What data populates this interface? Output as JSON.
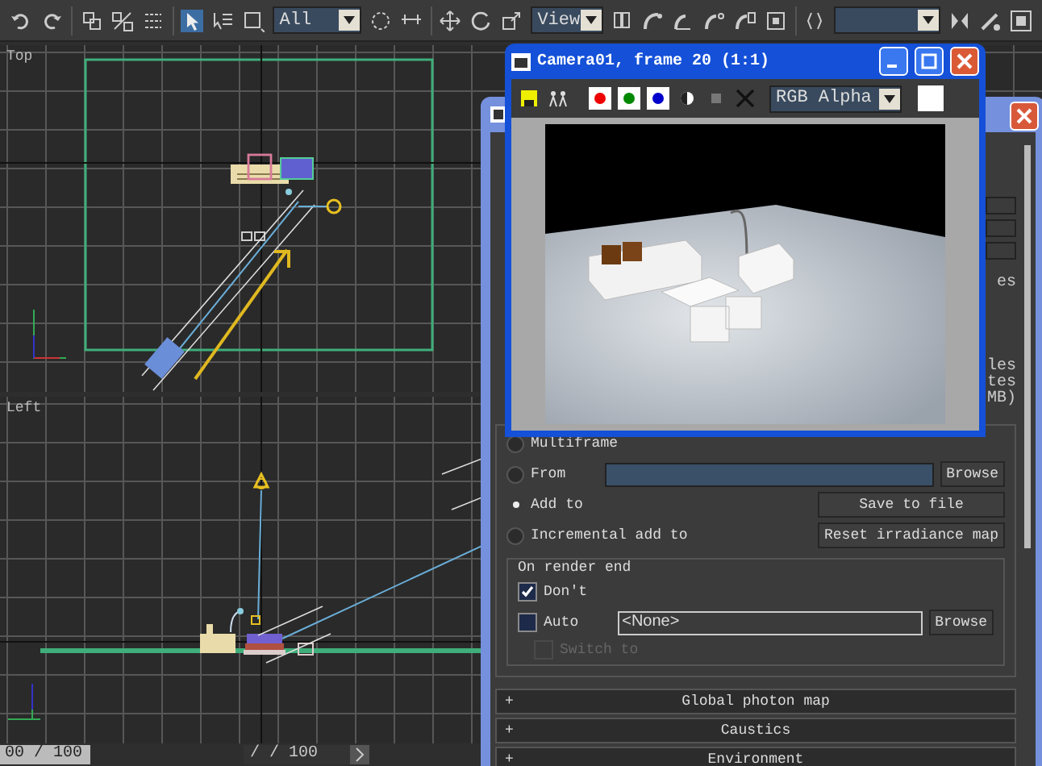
{
  "toolbar": {
    "dropdowns": [
      {
        "value": "All"
      },
      {
        "value": "View"
      }
    ]
  },
  "viewports": [
    {
      "label": "Top",
      "kind": "top"
    },
    {
      "label": "Left",
      "kind": "left"
    }
  ],
  "timeline": {
    "readouts": [
      "00 / 100",
      "/ / 100"
    ]
  },
  "render_setup": {
    "side_fragments": [
      "es",
      "les",
      "tes",
      "MB)"
    ],
    "radios": [
      {
        "label": "Multiframe",
        "selected": false,
        "kind": "plain"
      },
      {
        "label": "From",
        "selected": false,
        "kind": "path",
        "button": "Browse"
      },
      {
        "label": "Add to",
        "selected": true,
        "kind": "action",
        "button": "Save to file"
      },
      {
        "label": "Incremental add to",
        "selected": false,
        "kind": "action",
        "button": "Reset irradiance map"
      }
    ],
    "on_render_end": {
      "title": "On render end",
      "checks": [
        {
          "label": "Don't",
          "checked": true,
          "disabled": false,
          "kind": "plain"
        },
        {
          "label": "Auto",
          "checked": false,
          "disabled": false,
          "kind": "path",
          "value": "<None>",
          "button": "Browse"
        },
        {
          "label": "Switch to",
          "checked": false,
          "disabled": true,
          "kind": "plain"
        }
      ]
    },
    "rollouts": [
      {
        "sign": "+",
        "label": "Global photon map"
      },
      {
        "sign": "+",
        "label": "Caustics"
      },
      {
        "sign": "+",
        "label": "Environment"
      }
    ]
  },
  "frame_buffer": {
    "title": "Camera01, frame 20 (1:1)",
    "channel": "RGB Alpha"
  }
}
